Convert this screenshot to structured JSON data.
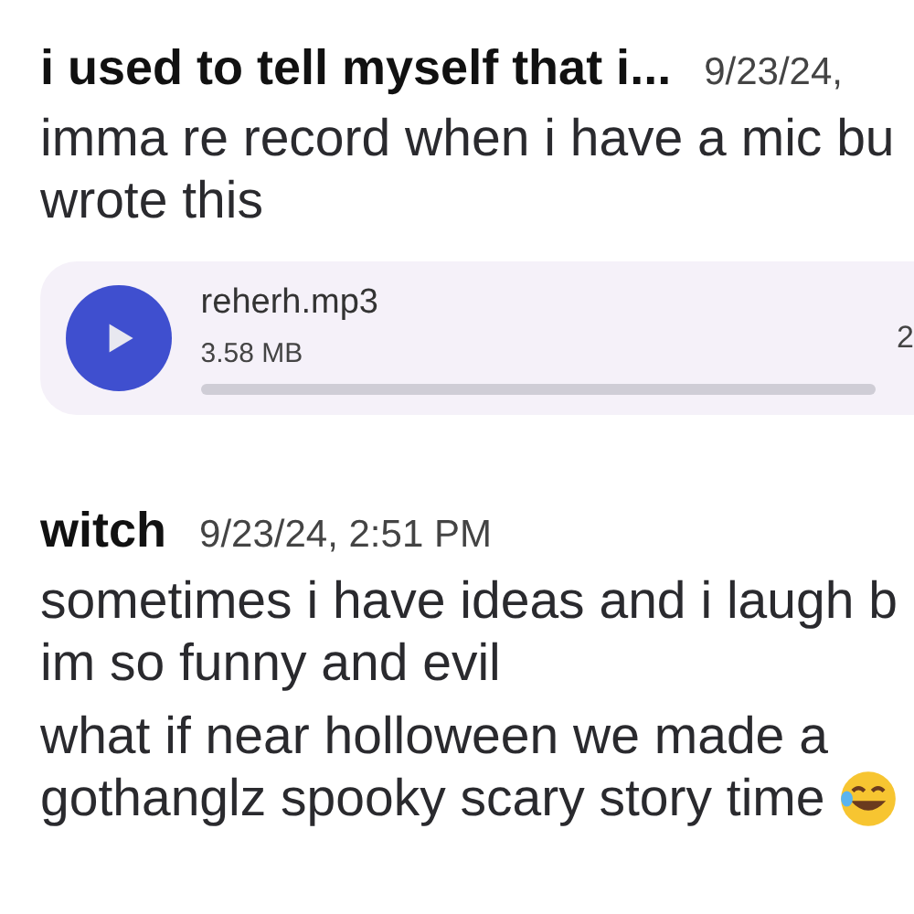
{
  "messages": [
    {
      "author": "i used to tell myself that i...",
      "timestamp": "9/23/24,",
      "paragraphs": [
        [
          "imma re record when i have a mic bu",
          "wrote this"
        ]
      ],
      "attachment": {
        "file_name": "reherh.mp3",
        "size": "3.58 MB",
        "column_3": "2"
      }
    },
    {
      "author": "witch",
      "timestamp": "9/23/24, 2:51 PM",
      "paragraphs": [
        [
          "sometimes i have ideas and i laugh b",
          "im so funny and evil"
        ],
        [
          "what if near holloween we made a",
          "gothanglz spooky scary story time"
        ]
      ],
      "ends_with_emoji": true
    }
  ]
}
